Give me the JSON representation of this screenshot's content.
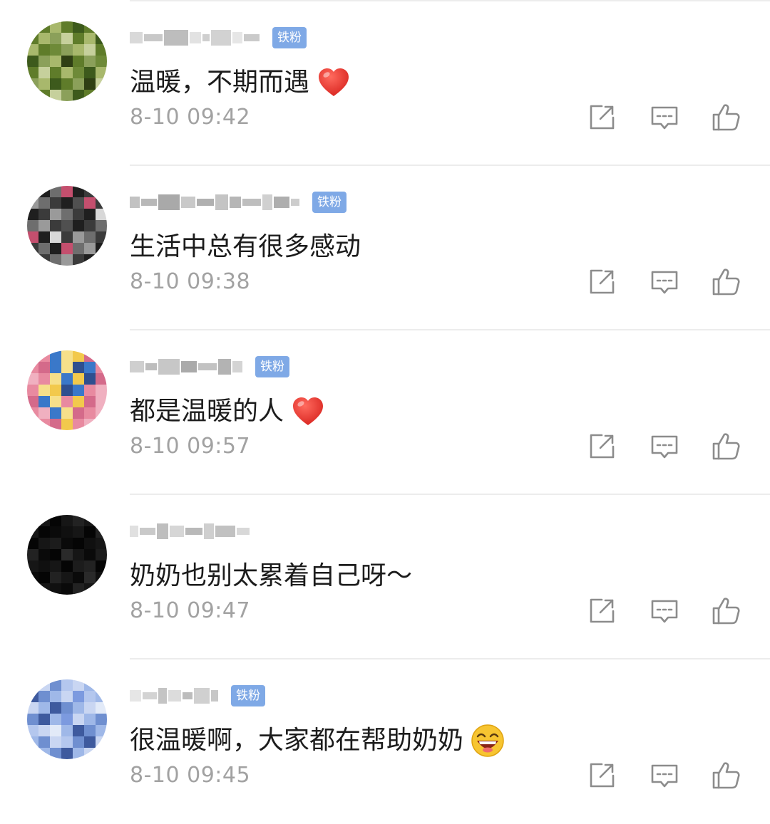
{
  "comments": [
    {
      "badge": "铁粉",
      "text": "温暖，不期而遇",
      "emoji": "red-heart",
      "time": "8-10 09:42",
      "avatar_palette": [
        "#8ba05a",
        "#5f7c2a",
        "#a8b86c",
        "#3d5a1c",
        "#c6d09c",
        "#6e8a38",
        "#2f3f14"
      ]
    },
    {
      "badge": "铁粉",
      "text": "生活中总有很多感动",
      "emoji": "",
      "time": "8-10 09:38",
      "avatar_palette": [
        "#3b3b3b",
        "#6e6e6e",
        "#1f1f1f",
        "#9a9a9a",
        "#c44f6e",
        "#505050",
        "#d8d8d8"
      ]
    },
    {
      "badge": "铁粉",
      "text": "都是温暖的人",
      "emoji": "red-heart",
      "time": "8-10 09:57",
      "avatar_palette": [
        "#e88aa0",
        "#f2c94c",
        "#3a78c9",
        "#f0b0c0",
        "#d46a8a",
        "#2f4f8f",
        "#f6e08a"
      ]
    },
    {
      "badge": "",
      "text": "奶奶也别太累着自己呀～",
      "emoji": "",
      "time": "8-10 09:47",
      "avatar_palette": [
        "#0a0a0a",
        "#161616",
        "#050505",
        "#222222",
        "#101010",
        "#1c1c1c",
        "#2a2a2a"
      ]
    },
    {
      "badge": "铁粉",
      "text": "很温暖啊，大家都在帮助奶奶",
      "emoji": "laughing-face",
      "time": "8-10 09:45",
      "avatar_palette": [
        "#9fb8e8",
        "#6f8fd0",
        "#c9d6f2",
        "#3e5a9e",
        "#b4c7ee",
        "#7c9adf",
        "#e2eaf8"
      ]
    }
  ],
  "actions": {
    "share_icon": "share-icon",
    "reply_icon": "comment-icon",
    "like_icon": "thumbs-up-icon"
  },
  "colors": {
    "badge_bg": "#7fa9e6",
    "time_text": "#a2a2a2",
    "body_text": "#1c1c1c",
    "icon_stroke": "#8c8c8c",
    "heart": "#e8302d"
  }
}
